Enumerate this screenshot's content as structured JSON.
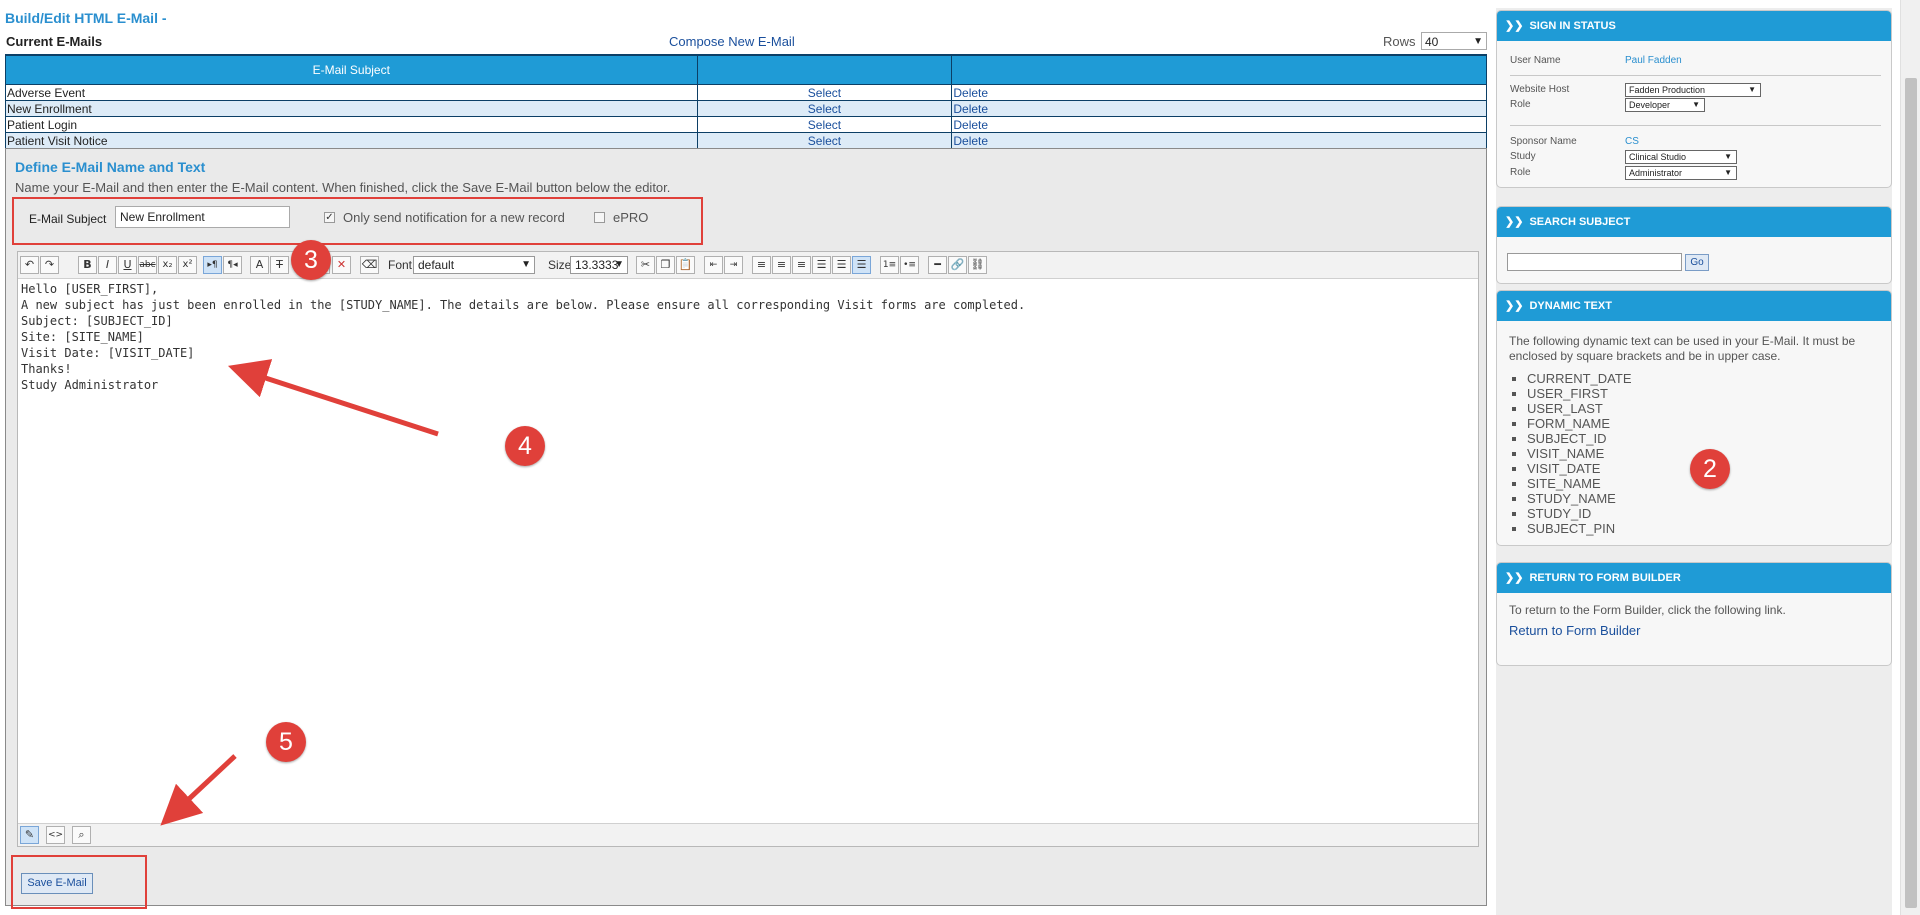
{
  "page": {
    "title": "Build/Edit HTML E-Mail -"
  },
  "emails_section": {
    "title": "Current E-Mails",
    "compose_link": "Compose New E-Mail",
    "rows_label": "Rows",
    "rows_value": "40",
    "columns": [
      "E-Mail Subject",
      "",
      ""
    ],
    "rows": [
      {
        "subject": "Adverse Event",
        "select": "Select",
        "delete": "Delete"
      },
      {
        "subject": "New Enrollment",
        "select": "Select",
        "delete": "Delete"
      },
      {
        "subject": "Patient Login",
        "select": "Select",
        "delete": "Delete"
      },
      {
        "subject": "Patient Visit Notice",
        "select": "Select",
        "delete": "Delete"
      }
    ]
  },
  "define": {
    "title": "Define E-Mail Name and Text",
    "help": "Name your E-Mail and then enter the E-Mail content. When finished, click the Save E-Mail button below the editor.",
    "subject_label": "E-Mail Subject",
    "subject_value": "New Enrollment",
    "only_new_label": "Only send notification for a new record",
    "only_new_checked": true,
    "epro_label": "ePRO",
    "epro_checked": false
  },
  "editor": {
    "font_label": "Font",
    "font_value": "default",
    "size_label": "Size",
    "size_value": "13.3333",
    "content": [
      "Hello [USER_FIRST],",
      "",
      "A new subject has just been enrolled in the [STUDY_NAME]. The details are below. Please ensure all corresponding Visit forms are completed.",
      "",
      "Subject: [SUBJECT_ID]",
      "Site: [SITE_NAME]",
      "Visit Date: [VISIT_DATE]",
      "",
      "",
      "Thanks!",
      "",
      "Study Administrator"
    ]
  },
  "save_button": "Save E-Mail",
  "callouts": [
    "2",
    "3",
    "4",
    "5"
  ],
  "sidebar": {
    "sign_in": {
      "title": "SIGN IN STATUS",
      "user_name_label": "User Name",
      "user_name": "Paul Fadden",
      "host_label": "Website Host",
      "host_value": "Fadden Production",
      "role_label": "Role",
      "role_value": "Developer",
      "sponsor_label": "Sponsor Name",
      "sponsor_value": "CS",
      "study_label": "Study",
      "study_value": "Clinical Studio",
      "role2_label": "Role",
      "role2_value": "Administrator"
    },
    "search": {
      "title": "SEARCH SUBJECT",
      "go": "Go"
    },
    "dynamic": {
      "title": "DYNAMIC TEXT",
      "intro": "The following dynamic text can be used in your E-Mail. It must be enclosed by square brackets and be in upper case.",
      "items": [
        "CURRENT_DATE",
        "USER_FIRST",
        "USER_LAST",
        "FORM_NAME",
        "SUBJECT_ID",
        "VISIT_NAME",
        "VISIT_DATE",
        "SITE_NAME",
        "STUDY_NAME",
        "STUDY_ID",
        "SUBJECT_PIN"
      ]
    },
    "return": {
      "title": "RETURN TO FORM BUILDER",
      "text": "To return to the Form Builder, click the following link.",
      "link": "Return to Form Builder"
    }
  },
  "colors": {
    "accent": "#1f9bd6",
    "title": "#2a8fcf",
    "highlight": "#e0403a",
    "link": "#1a4f9c"
  }
}
